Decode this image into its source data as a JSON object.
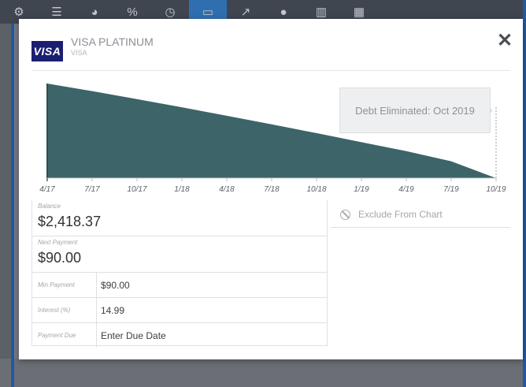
{
  "toolbar": {
    "icons": [
      "settings-icon",
      "list-icon",
      "pie-chart-icon",
      "percent-icon",
      "clock-icon",
      "credit-card-icon",
      "trend-icon",
      "alert-icon",
      "bar-chart-icon",
      "calendar-icon"
    ],
    "active_index": 5
  },
  "modal": {
    "logo_text": "VISA",
    "account_name": "VISA PLATINUM",
    "account_sub": "VISA",
    "close_label": "✕"
  },
  "chart_data": {
    "type": "area",
    "title": "",
    "xlabel": "",
    "ylabel": "",
    "categories": [
      "4/17",
      "7/17",
      "10/17",
      "1/18",
      "4/18",
      "7/18",
      "10/18",
      "1/19",
      "4/19",
      "7/19",
      "10/19"
    ],
    "series": [
      {
        "values": [
          2418.37,
          2225,
          2020,
          1810,
          1595,
          1375,
          1150,
          920,
          690,
          430,
          0
        ]
      }
    ],
    "fill_color": "#3c6469",
    "annotation": "Debt Eliminated: Oct 2019",
    "grid": false
  },
  "details": {
    "balance_label": "Balance",
    "balance_value": "$2,418.37",
    "next_payment_label": "Next Payment",
    "next_payment_value": "$90.00",
    "rows": [
      {
        "label": "Min Payment",
        "value": "$90.00"
      },
      {
        "label": "Interest (%)",
        "value": "14.99"
      },
      {
        "label": "Payment Due",
        "value": "Enter Due Date"
      }
    ],
    "exclude_label": "Exclude From Chart"
  }
}
